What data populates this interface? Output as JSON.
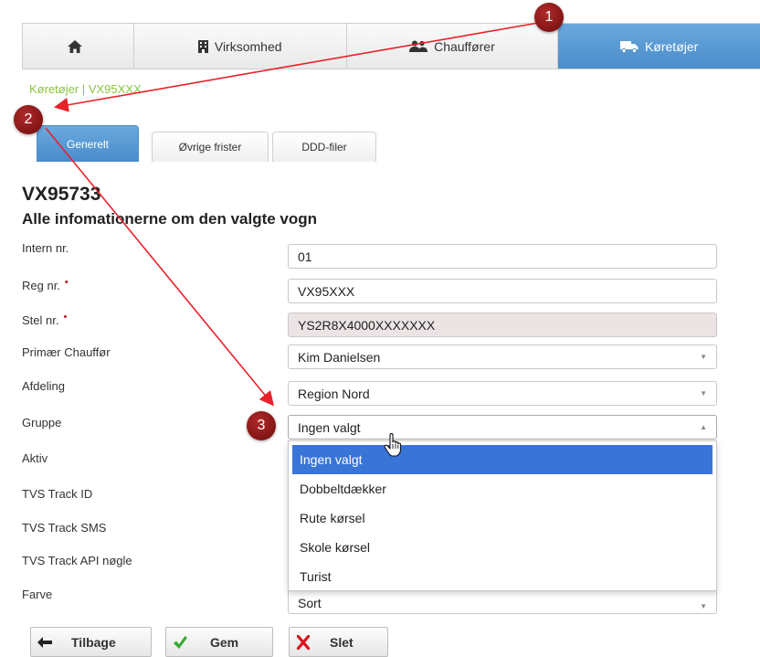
{
  "nav": {
    "items": [
      {
        "label": "",
        "icon": "home-icon"
      },
      {
        "label": "Virksomhed",
        "icon": "building-icon"
      },
      {
        "label": "Chauffører",
        "icon": "users-icon"
      },
      {
        "label": "Køretøjer",
        "icon": "truck-icon"
      }
    ],
    "active_color": "#4a8ccb"
  },
  "breadcrumb": {
    "section": "Køretøjer",
    "separator": "|",
    "current": "VX95XXX"
  },
  "tabs": [
    {
      "label": "Generelt",
      "active": true
    },
    {
      "label": "Øvrige frister",
      "active": false
    },
    {
      "label": "DDD-filer",
      "active": false
    }
  ],
  "page": {
    "title": "VX95733",
    "subtitle": "Alle infomationerne om den valgte vogn"
  },
  "form": {
    "intern_nr": {
      "label": "Intern nr.",
      "value": "01"
    },
    "reg_nr": {
      "label": "Reg nr.",
      "value": "VX95XXX",
      "required": true
    },
    "stel_nr": {
      "label": "Stel nr.",
      "value": "YS2R8X4000XXXXXXX",
      "required": true
    },
    "primaer_chauffor": {
      "label": "Primær Chauffør",
      "value": "Kim Danielsen"
    },
    "afdeling": {
      "label": "Afdeling",
      "value": "Region Nord"
    },
    "gruppe": {
      "label": "Gruppe",
      "value": "Ingen valgt"
    },
    "aktiv": {
      "label": "Aktiv"
    },
    "tvs_track_id": {
      "label": "TVS Track ID"
    },
    "tvs_track_sms": {
      "label": "TVS Track SMS"
    },
    "tvs_track_api": {
      "label": "TVS Track API nøgle"
    },
    "farve": {
      "label": "Farve",
      "value": "Sort"
    },
    "required_mark": "•"
  },
  "dropdown": {
    "options": [
      "Ingen valgt",
      "Dobbeltdækker",
      "Rute kørsel",
      "Skole kørsel",
      "Turist"
    ],
    "selected_index": 0,
    "highlight_color": "#3875d7"
  },
  "buttons": {
    "back": "Tilbage",
    "save": "Gem",
    "delete": "Slet"
  },
  "annotations": {
    "markers": [
      "1",
      "2",
      "3"
    ],
    "color": "#e8212a"
  }
}
